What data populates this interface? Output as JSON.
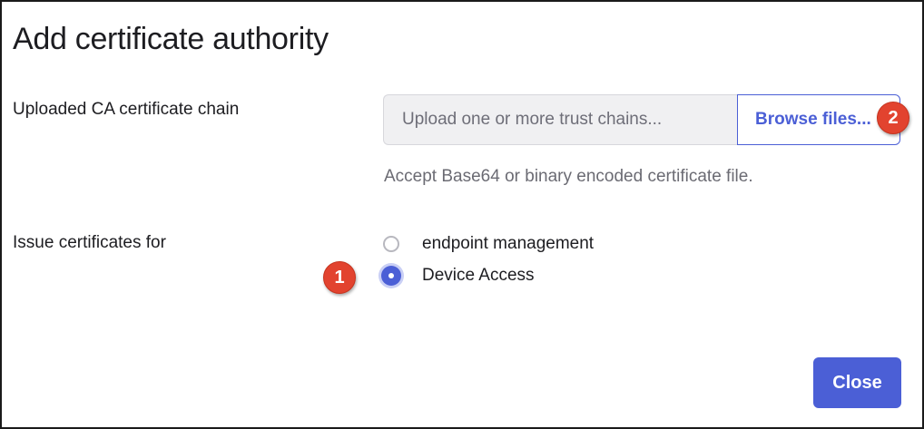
{
  "dialog": {
    "title": "Add certificate authority",
    "chain": {
      "label": "Uploaded CA certificate chain",
      "placeholder": "Upload one or more trust chains...",
      "browse_label": "Browse files...",
      "hint": "Accept Base64 or binary encoded certificate file."
    },
    "issue": {
      "label": "Issue certificates for",
      "options": [
        {
          "label": "endpoint management",
          "selected": false
        },
        {
          "label": "Device Access",
          "selected": true
        }
      ]
    },
    "close_label": "Close"
  },
  "annotations": {
    "badge1": "1",
    "badge2": "2"
  },
  "colors": {
    "accent": "#4b5fd6",
    "badge": "#e2432f"
  }
}
